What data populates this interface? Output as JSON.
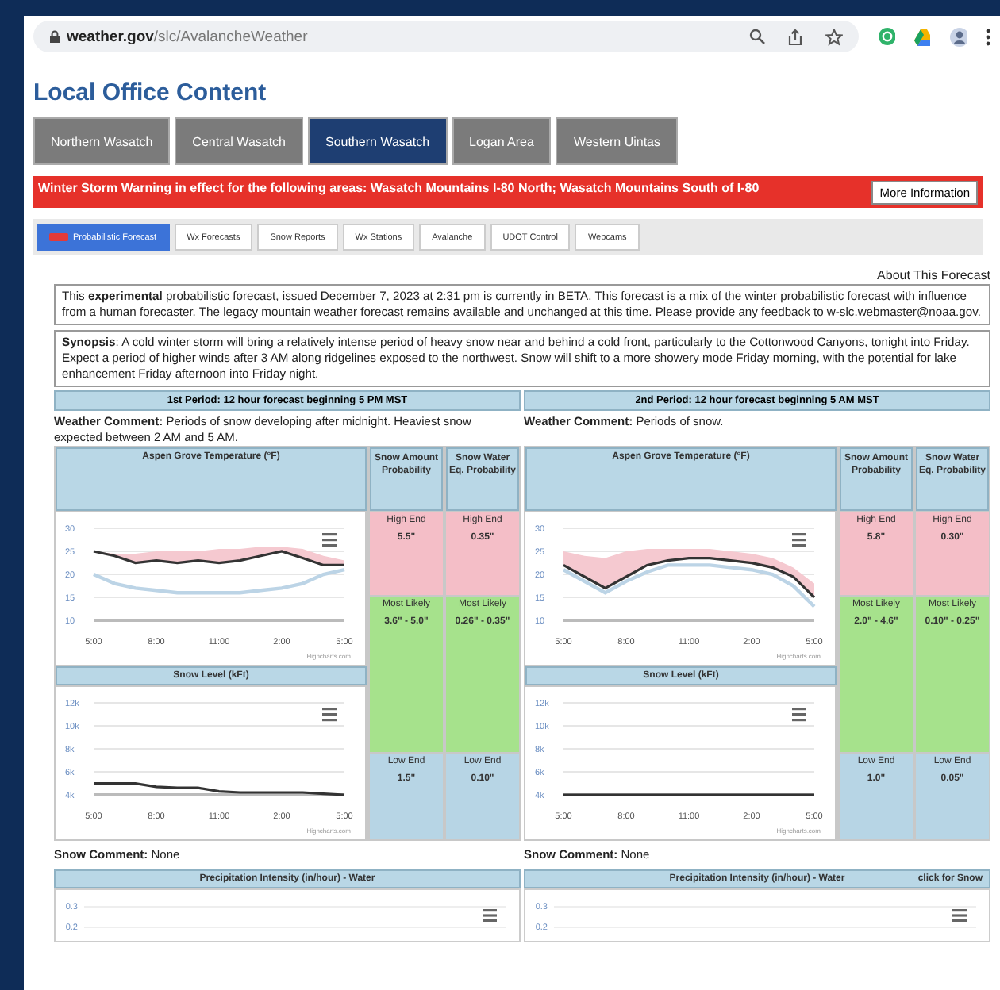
{
  "browser": {
    "url_host": "weather.gov",
    "url_path": "/slc/AvalancheWeather"
  },
  "page_title": "Local Office Content",
  "regions": [
    {
      "label": "Northern Wasatch",
      "selected": false
    },
    {
      "label": "Central Wasatch",
      "selected": false
    },
    {
      "label": "Southern Wasatch",
      "selected": true
    },
    {
      "label": "Logan Area",
      "selected": false
    },
    {
      "label": "Western Uintas",
      "selected": false
    }
  ],
  "alert": {
    "text": "Winter Storm Warning in effect for the following areas: Wasatch Mountains I-80 North; Wasatch Mountains South of I-80",
    "button": "More Information"
  },
  "tabs": [
    {
      "label": "Probabilistic Forecast",
      "selected": true,
      "badge": true
    },
    {
      "label": "Wx Forecasts",
      "selected": false,
      "badge": false
    },
    {
      "label": "Snow Reports",
      "selected": false,
      "badge": false
    },
    {
      "label": "Wx Stations",
      "selected": false,
      "badge": false
    },
    {
      "label": "Avalanche",
      "selected": false,
      "badge": false
    },
    {
      "label": "UDOT Control",
      "selected": false,
      "badge": false
    },
    {
      "label": "Webcams",
      "selected": false,
      "badge": false
    }
  ],
  "about_link": "About This Forecast",
  "intro": "This **experimental** probabilistic forecast, issued December 7, 2023 at 2:31 pm is currently in BETA. This forecast is a mix of the winter probabilistic forecast with influence from a human forecaster. The legacy mountain weather forecast remains available and unchanged at this time. Please provide any feedback to w-slc.webmaster@noaa.gov.",
  "synopsis": "**Synopsis**: A cold winter storm will bring a relatively intense period of heavy snow near and behind a cold front, particularly to the Cottonwood Canyons, tonight into Friday. Expect a period of higher winds after 3 AM along ridgelines exposed to the northwest. Snow will shift to a more showery mode Friday morning, with the potential for lake enhancement Friday afternoon into Friday night.",
  "periods": [
    {
      "header": "1st Period: 12 hour forecast beginning 5 PM MST",
      "weather_comment": "**Weather Comment:** Periods of snow developing after midnight. Heaviest snow expected between 2 AM and 5 AM.",
      "amount_header": "Snow Amount Probability",
      "water_header": "Snow Water Eq. Probability",
      "temp_chart": {
        "credit": "Highcharts.com",
        "chart_data": {
          "type": "line",
          "title": "Aspen Grove Temperature (°F)",
          "categories": [
            "5:00",
            null,
            null,
            "8:00",
            null,
            null,
            "11:00",
            null,
            null,
            "2:00",
            null,
            null,
            "5:00"
          ],
          "ylim": [
            10,
            30
          ],
          "yticks": [
            10,
            15,
            20,
            25,
            30
          ],
          "series": [
            {
              "type": "area",
              "color": "#f5c9d0",
              "values": [
                25,
                24.5,
                24.5,
                25,
                25,
                25,
                25.5,
                25.5,
                26,
                26,
                25.5,
                24,
                23
              ]
            },
            {
              "type": "line",
              "color": "#333333",
              "values": [
                25,
                24,
                22.5,
                23,
                22.5,
                23,
                22.5,
                23,
                24,
                25,
                23.5,
                22,
                22
              ]
            },
            {
              "type": "line",
              "color": "#bcd4e6",
              "values": [
                20,
                18,
                17,
                16.5,
                16,
                16,
                16,
                16,
                16.5,
                17,
                18,
                20,
                21
              ]
            }
          ],
          "grid": true
        }
      },
      "snow_level_chart": {
        "credit": "Highcharts.com",
        "chart_data": {
          "type": "line",
          "title": "Snow Level (kFt)",
          "categories": [
            "5:00",
            null,
            null,
            "8:00",
            null,
            null,
            "11:00",
            null,
            null,
            "2:00",
            null,
            null,
            "5:00"
          ],
          "ylim": [
            4000,
            12000
          ],
          "yticks": [
            {
              "value": 4000,
              "label": "4k"
            },
            {
              "value": 6000,
              "label": "6k"
            },
            {
              "value": 8000,
              "label": "8k"
            },
            {
              "value": 10000,
              "label": "10k"
            },
            {
              "value": 12000,
              "label": "12k"
            }
          ],
          "series": [
            {
              "type": "line",
              "color": "#333333",
              "values": [
                5000,
                5000,
                5000,
                4700,
                4600,
                4600,
                4300,
                4200,
                4200,
                4200,
                4200,
                4100,
                4000
              ]
            }
          ],
          "grid": true
        }
      },
      "probabilities": [
        {
          "kind": "high",
          "cells": [
            {
              "label": "High End",
              "value": "5.5\""
            },
            {
              "label": "High End",
              "value": "0.35\""
            }
          ]
        },
        {
          "kind": "likely",
          "cells": [
            {
              "label": "Most Likely",
              "value": "3.6\" - 5.0\""
            },
            {
              "label": "Most Likely",
              "value": "0.26\" - 0.35\""
            }
          ]
        },
        {
          "kind": "low",
          "cells": [
            {
              "label": "Low End",
              "value": "1.5\""
            },
            {
              "label": "Low End",
              "value": "0.10\""
            }
          ]
        }
      ],
      "snow_comment": "**Snow Comment:** None",
      "precip": {
        "title": "Precipitation Intensity (in/hour) - Water",
        "y_tick_labels": [
          "0.3",
          "0.2"
        ]
      }
    },
    {
      "header": "2nd Period: 12 hour forecast beginning 5 AM MST",
      "weather_comment": "**Weather Comment:** Periods of snow.",
      "amount_header": "Snow Amount Probability",
      "water_header": "Snow Water Eq. Probability",
      "temp_chart": {
        "credit": "Highcharts.com",
        "chart_data": {
          "type": "line",
          "title": "Aspen Grove Temperature (°F)",
          "categories": [
            "5:00",
            null,
            null,
            "8:00",
            null,
            null,
            "11:00",
            null,
            null,
            "2:00",
            null,
            null,
            "5:00"
          ],
          "ylim": [
            10,
            30
          ],
          "yticks": [
            10,
            15,
            20,
            25,
            30
          ],
          "series": [
            {
              "type": "area",
              "color": "#f5c9d0",
              "values": [
                25,
                24,
                23.5,
                25,
                25.5,
                25.5,
                25.5,
                25.5,
                25,
                24.5,
                23.5,
                21.5,
                18
              ]
            },
            {
              "type": "line",
              "color": "#333333",
              "values": [
                22,
                19.5,
                17,
                19.5,
                22,
                23,
                23.5,
                23.5,
                23,
                22.5,
                21.5,
                19.5,
                15
              ]
            },
            {
              "type": "line",
              "color": "#bcd4e6",
              "values": [
                21,
                18.5,
                16,
                18.5,
                20.5,
                22,
                22,
                22,
                21.5,
                21,
                20,
                17.5,
                13
              ]
            }
          ],
          "grid": true
        }
      },
      "snow_level_chart": {
        "credit": "Highcharts.com",
        "chart_data": {
          "type": "line",
          "title": "Snow Level (kFt)",
          "categories": [
            "5:00",
            null,
            null,
            "8:00",
            null,
            null,
            "11:00",
            null,
            null,
            "2:00",
            null,
            null,
            "5:00"
          ],
          "ylim": [
            4000,
            12000
          ],
          "yticks": [
            {
              "value": 4000,
              "label": "4k"
            },
            {
              "value": 6000,
              "label": "6k"
            },
            {
              "value": 8000,
              "label": "8k"
            },
            {
              "value": 10000,
              "label": "10k"
            },
            {
              "value": 12000,
              "label": "12k"
            }
          ],
          "series": [
            {
              "type": "line",
              "color": "#333333",
              "values": [
                4000,
                4000,
                4000,
                4000,
                4000,
                4000,
                4000,
                4000,
                4000,
                4000,
                4000,
                4000,
                4000
              ]
            }
          ],
          "grid": true
        }
      },
      "probabilities": [
        {
          "kind": "high",
          "cells": [
            {
              "label": "High End",
              "value": "5.8\""
            },
            {
              "label": "High End",
              "value": "0.30\""
            }
          ]
        },
        {
          "kind": "likely",
          "cells": [
            {
              "label": "Most Likely",
              "value": "2.0\" - 4.6\""
            },
            {
              "label": "Most Likely",
              "value": "0.10\" - 0.25\""
            }
          ]
        },
        {
          "kind": "low",
          "cells": [
            {
              "label": "Low End",
              "value": "1.0\""
            },
            {
              "label": "Low End",
              "value": "0.05\""
            }
          ]
        }
      ],
      "snow_comment": "**Snow Comment:** None",
      "precip": {
        "title": "Precipitation Intensity (in/hour) - Water",
        "link": "click for Snow",
        "y_tick_labels": [
          "0.3",
          "0.2"
        ]
      }
    }
  ]
}
